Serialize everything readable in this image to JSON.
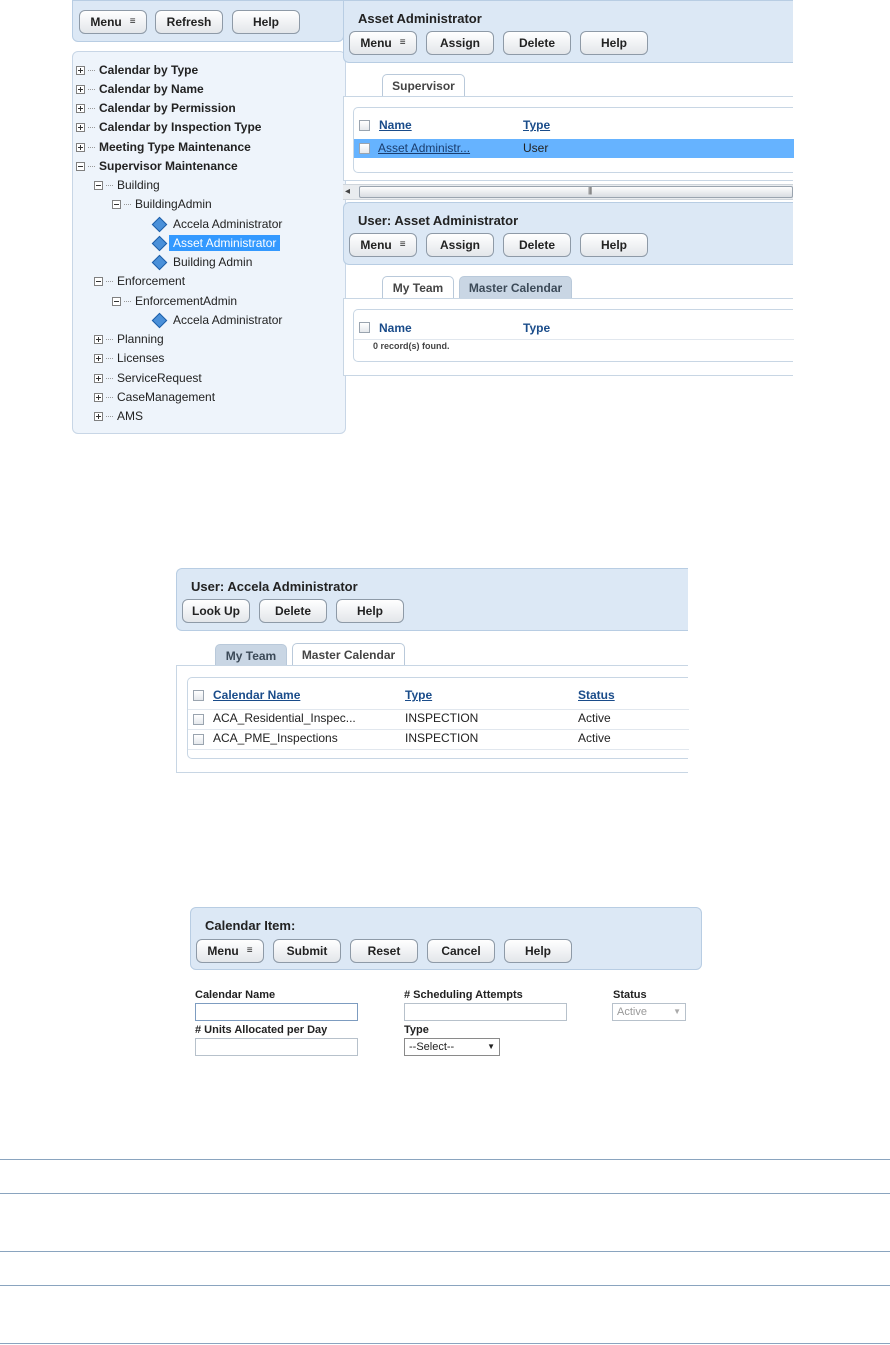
{
  "left_toolbar": {
    "menu": "Menu",
    "refresh": "Refresh",
    "help": "Help"
  },
  "tree": {
    "roots": [
      "Calendar by Type",
      "Calendar by Name",
      "Calendar by Permission",
      "Calendar by Inspection Type",
      "Meeting Type Maintenance",
      "Supervisor Maintenance"
    ],
    "building": "Building",
    "building_admin": "BuildingAdmin",
    "building_users": [
      "Accela Administrator",
      "Asset Administrator",
      "Building Admin"
    ],
    "enforcement": "Enforcement",
    "enforcement_admin": "EnforcementAdmin",
    "enforcement_users": [
      "Accela Administrator"
    ],
    "other_groups": [
      "Planning",
      "Licenses",
      "ServiceRequest",
      "CaseManagement",
      "AMS"
    ]
  },
  "asset_panel": {
    "title": "Asset Administrator",
    "menu": "Menu",
    "assign": "Assign",
    "delete": "Delete",
    "help": "Help",
    "tab": "Supervisor",
    "columns": [
      "Name",
      "Type"
    ],
    "rows": [
      {
        "name": "Asset Administr...",
        "type": "User"
      }
    ]
  },
  "scrollbar": {
    "left": "◂",
    "grip": "|||"
  },
  "user_asset_panel": {
    "title": "User: Asset Administrator",
    "menu": "Menu",
    "assign": "Assign",
    "delete": "Delete",
    "help": "Help",
    "tabs": [
      "My Team",
      "Master Calendar"
    ],
    "columns": [
      "Name",
      "Type"
    ],
    "empty": "0 record(s) found."
  },
  "user_accela_panel": {
    "title": "User: Accela Administrator",
    "lookup": "Look Up",
    "delete": "Delete",
    "help": "Help",
    "tabs": [
      "My Team",
      "Master Calendar"
    ],
    "columns": [
      "Calendar Name",
      "Type",
      "Status"
    ],
    "rows": [
      {
        "name": "ACA_Residential_Inspec...",
        "type": "INSPECTION",
        "status": "Active"
      },
      {
        "name": "ACA_PME_Inspections",
        "type": "INSPECTION",
        "status": "Active"
      }
    ]
  },
  "calendar_item": {
    "title": "Calendar Item:",
    "menu": "Menu",
    "submit": "Submit",
    "reset": "Reset",
    "cancel": "Cancel",
    "help": "Help",
    "labels": {
      "calendar_name": "Calendar Name",
      "scheduling_attempts": "# Scheduling Attempts",
      "status": "Status",
      "units_per_day": "# Units Allocated per Day",
      "type": "Type"
    },
    "status_value": "Active",
    "type_value": "--Select--"
  },
  "icons": {
    "menu_caret": "≡▾ caret-icon",
    "tree_node": "diamond-user-icon"
  },
  "colors": {
    "panel_bg": "#dce8f5",
    "selected": "#3399ff",
    "link": "#1a4c8a"
  }
}
